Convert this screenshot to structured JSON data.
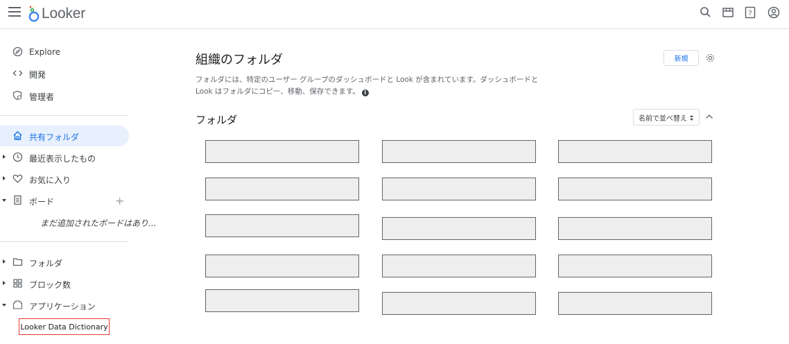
{
  "app": {
    "logo_text": "Looker"
  },
  "sidebar": {
    "top_items": [
      {
        "label": "Explore",
        "icon": "compass-icon"
      },
      {
        "label": "開発",
        "icon": "code-icon"
      },
      {
        "label": "管理者",
        "icon": "admin-icon"
      }
    ],
    "shared_folders": {
      "label": "共有フォルダ",
      "icon": "home-icon"
    },
    "recent": {
      "label": "最近表示したもの",
      "icon": "clock-icon"
    },
    "favorites": {
      "label": "お気に入り",
      "icon": "heart-icon"
    },
    "boards": {
      "label": "ボード",
      "icon": "board-icon",
      "empty_text": "まだ追加されたボードはあり..."
    },
    "folders": {
      "label": "フォルダ",
      "icon": "folder-icon"
    },
    "blocks": {
      "label": "ブロック数",
      "icon": "blocks-icon"
    },
    "applications": {
      "label": "アプリケーション",
      "icon": "apps-icon",
      "items": [
        "Looker Data Dictionary"
      ]
    }
  },
  "main": {
    "title": "組織のフォルダ",
    "description": "フォルダには、特定のユーザー グループのダッシュボードと Look が含まれています。ダッシュボードと Look はフォルダにコピー、移動、保存できます。",
    "new_button": "新規",
    "section_title": "フォルダ",
    "sort_label": "名前で並べ替え",
    "folder_card_count": 15
  },
  "colors": {
    "accent": "#1a73e8",
    "active_bg": "#e8f0fe",
    "highlight_border": "#e53935",
    "card_bg": "#eeeeee"
  }
}
